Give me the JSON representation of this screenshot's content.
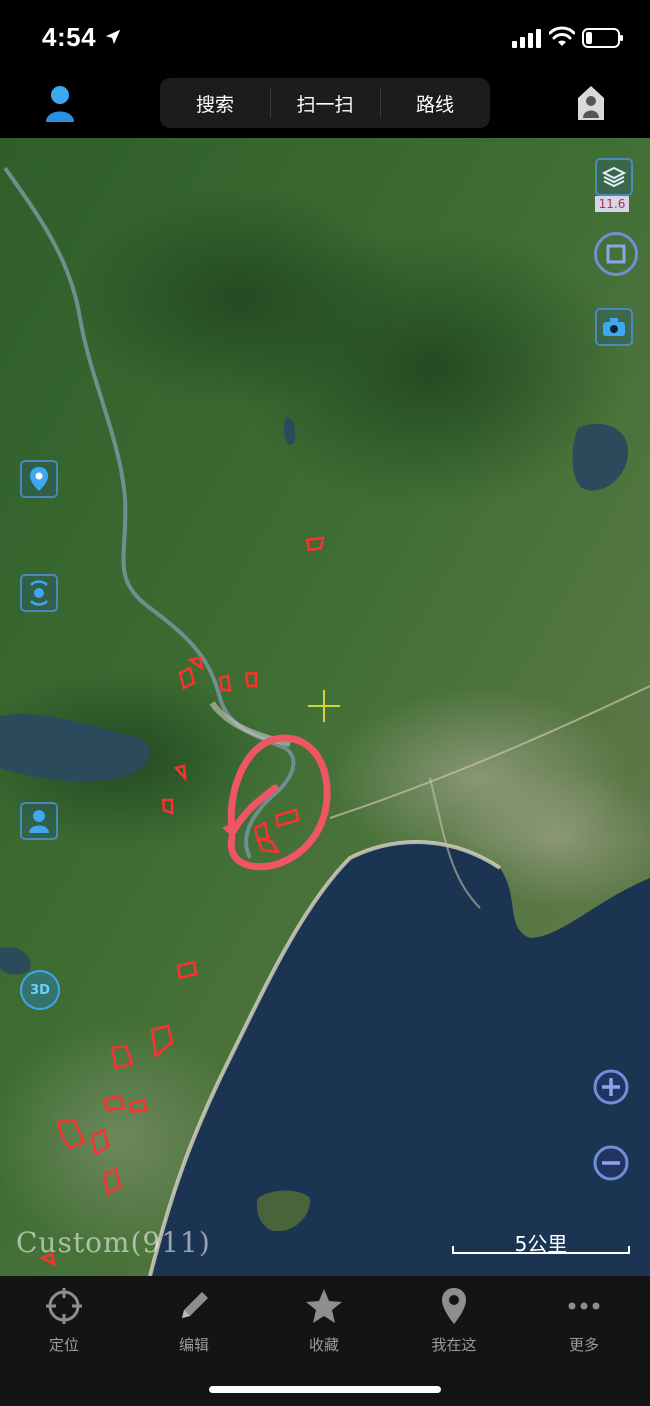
{
  "status_bar": {
    "time": "4:54",
    "icons": [
      "location-arrow-icon",
      "signal-icon",
      "wifi-icon",
      "battery-icon"
    ]
  },
  "top_nav": {
    "user_icon": "user-avatar-icon",
    "tabs": [
      {
        "label": "搜索"
      },
      {
        "label": "扫一扫"
      },
      {
        "label": "路线"
      }
    ],
    "home_icon": "home-icon"
  },
  "map": {
    "type": "satellite",
    "right_controls": [
      {
        "icon": "layers-icon",
        "badge": "11.6"
      },
      {
        "icon": "square-frame-icon"
      },
      {
        "icon": "camera-icon"
      }
    ],
    "left_controls": [
      {
        "icon": "location-pin-icon"
      },
      {
        "icon": "signal-waves-icon"
      },
      {
        "icon": "user-marker-icon"
      },
      {
        "icon": "3d-icon",
        "label": "3D"
      }
    ],
    "zoom_controls": [
      {
        "icon": "zoom-in-icon"
      },
      {
        "icon": "zoom-out-icon"
      }
    ],
    "source_label": "Custom(911)",
    "scale": "5公里",
    "colors": {
      "land": "#3c6b2f",
      "sea": "#1b3452",
      "marker": "#ff3030",
      "annotation": "#f05566",
      "crosshair": "#d6d23a",
      "control": "#6f8fd6"
    }
  },
  "bottom_bar": {
    "items": [
      {
        "label": "定位",
        "icon": "crosshair-target-icon"
      },
      {
        "label": "编辑",
        "icon": "pencil-icon"
      },
      {
        "label": "收藏",
        "icon": "star-icon"
      },
      {
        "label": "我在这",
        "icon": "map-pin-icon"
      },
      {
        "label": "更多",
        "icon": "more-dots-icon"
      }
    ]
  }
}
